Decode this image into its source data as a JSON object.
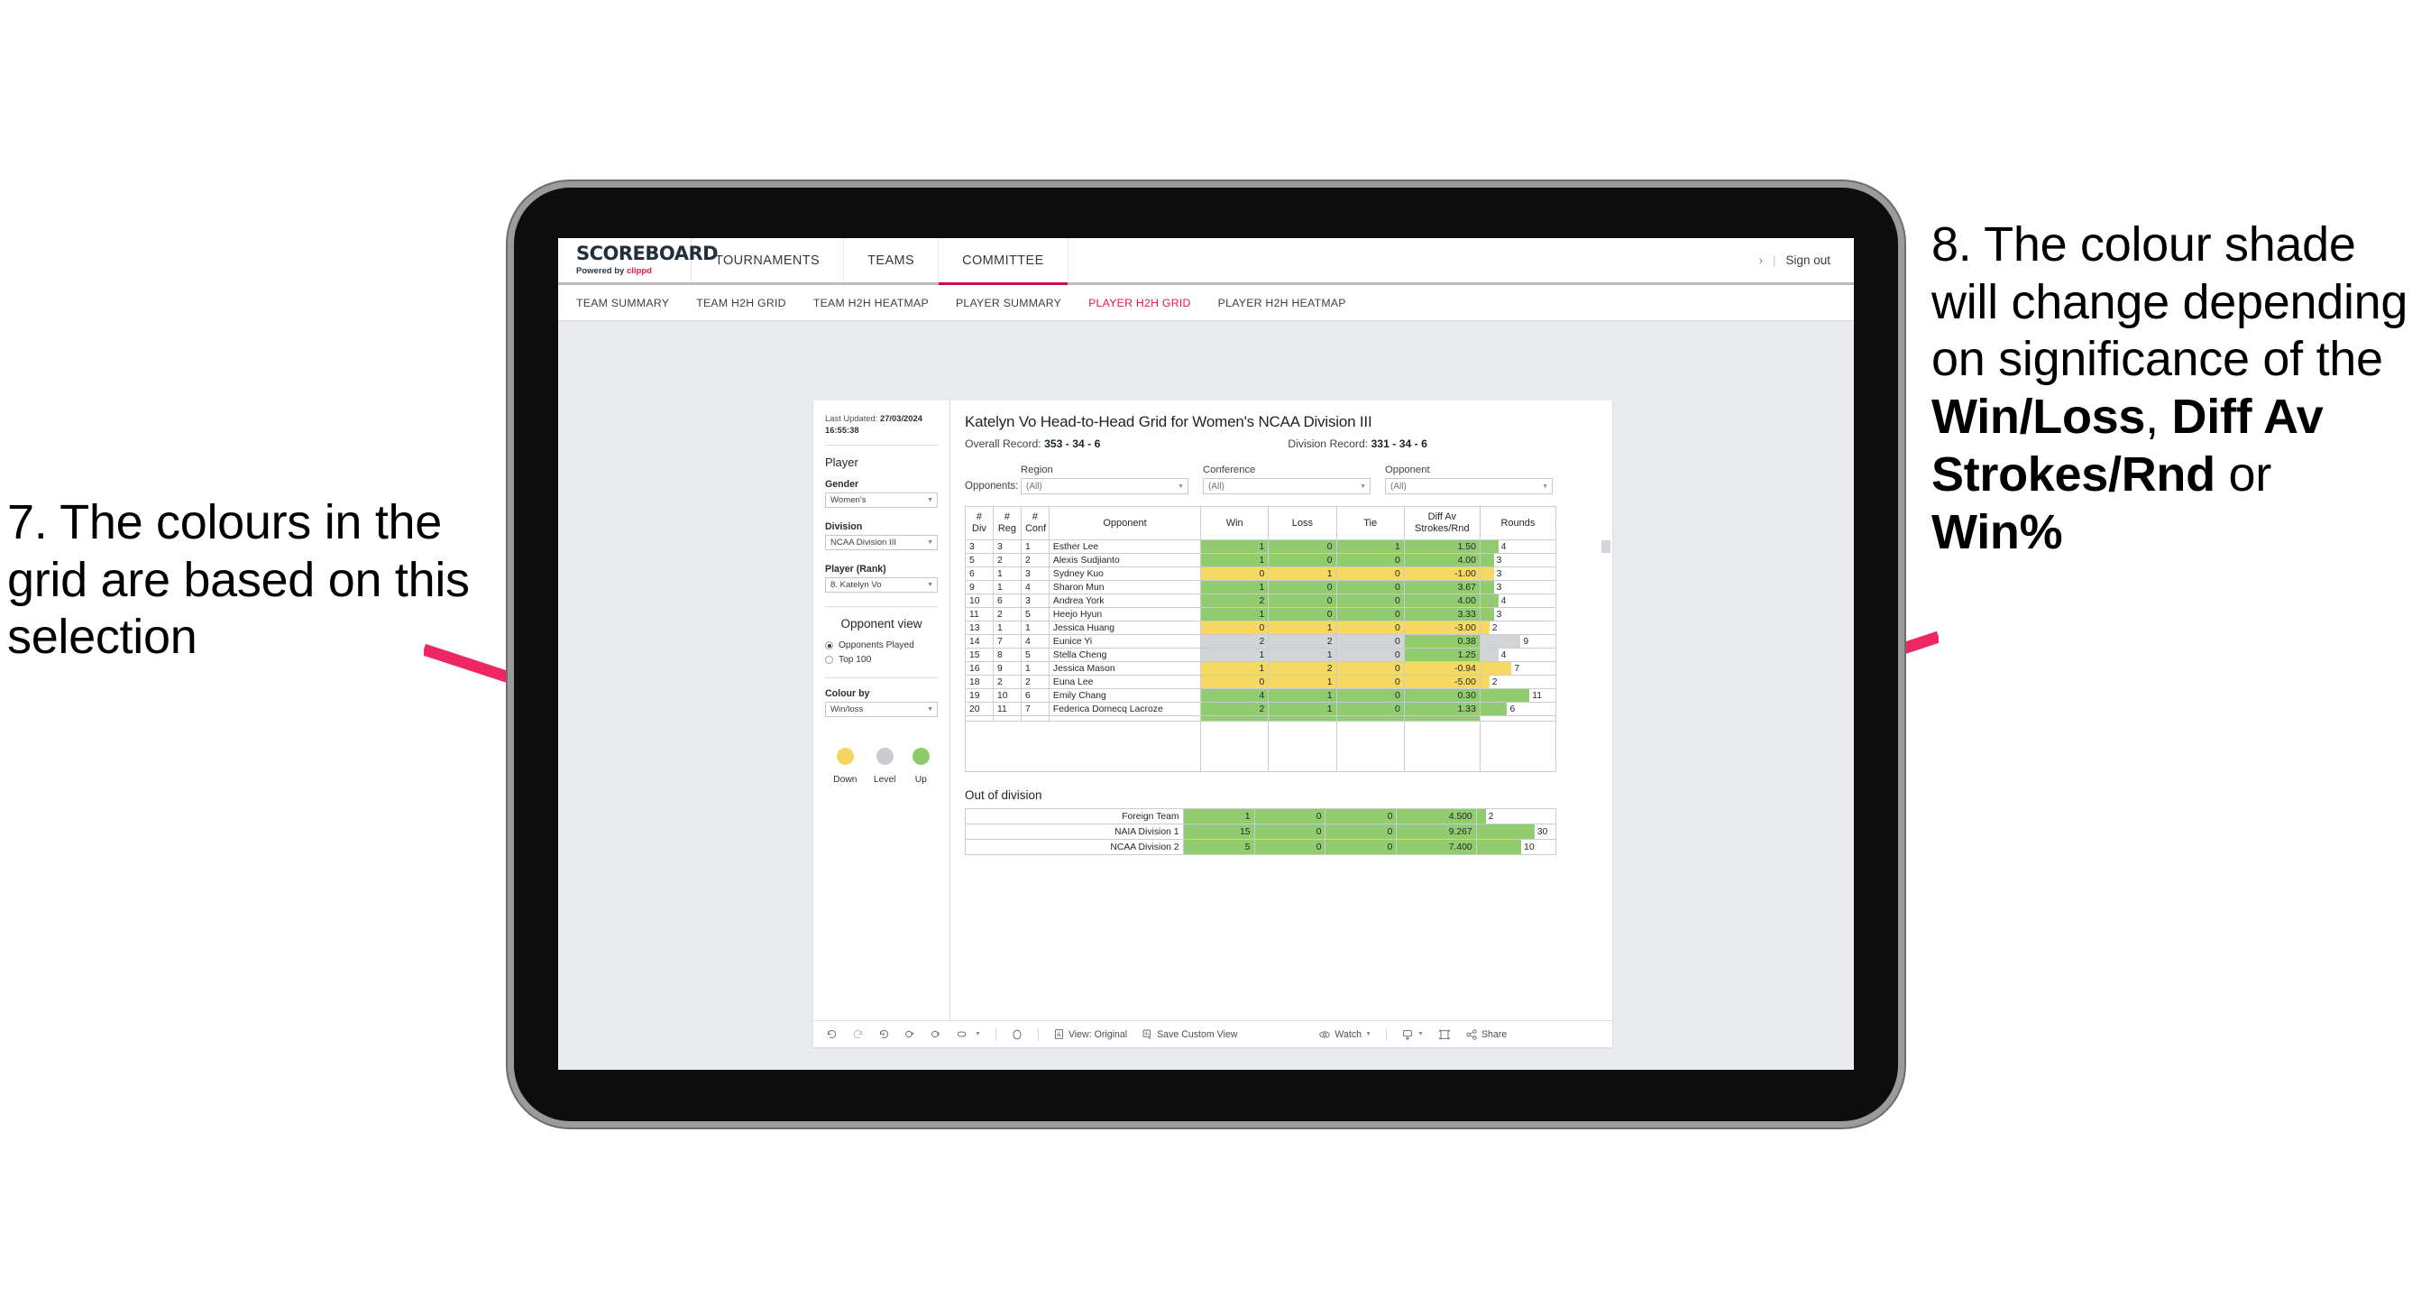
{
  "annotations": {
    "left": "7. The colours in the grid are based on this selection",
    "right_prefix": "8. The colour shade will change depending on significance of the ",
    "right_b1": "Win/Loss",
    "right_mid1": ", ",
    "right_b2": "Diff Av Strokes/Rnd",
    "right_mid2": " or ",
    "right_b3": "Win%"
  },
  "app": {
    "logo_main": "SCOREBOARD",
    "logo_sub_prefix": "Powered by ",
    "logo_sub_brand": "clippd",
    "top_nav": [
      {
        "label": "TOURNAMENTS",
        "active": false
      },
      {
        "label": "TEAMS",
        "active": false
      },
      {
        "label": "COMMITTEE",
        "active": true
      }
    ],
    "signout": {
      "chevron": "›",
      "divider": "|",
      "label": "Sign out"
    },
    "sub_nav": [
      {
        "label": "TEAM SUMMARY",
        "active": false
      },
      {
        "label": "TEAM H2H GRID",
        "active": false
      },
      {
        "label": "TEAM H2H HEATMAP",
        "active": false
      },
      {
        "label": "PLAYER SUMMARY",
        "active": false
      },
      {
        "label": "PLAYER H2H GRID",
        "active": true
      },
      {
        "label": "PLAYER H2H HEATMAP",
        "active": false
      }
    ],
    "accent_color": "#e8174c"
  },
  "sidebar": {
    "last_updated_label": "Last Updated:",
    "last_updated_value": "27/03/2024 16:55:38",
    "player_heading": "Player",
    "gender_label": "Gender",
    "gender_value": "Women's",
    "division_label": "Division",
    "division_value": "NCAA Division III",
    "player_rank_label": "Player (Rank)",
    "player_rank_value": "8. Katelyn Vo",
    "opponent_view_heading": "Opponent view",
    "opponent_view_options": [
      {
        "label": "Opponents Played",
        "selected": true
      },
      {
        "label": "Top 100",
        "selected": false
      }
    ],
    "colour_by_label": "Colour by",
    "colour_by_value": "Win/loss",
    "legend": [
      {
        "caption": "Down",
        "color": "#f5d45f"
      },
      {
        "caption": "Level",
        "color": "#c9cbce"
      },
      {
        "caption": "Up",
        "color": "#8ccb68"
      }
    ]
  },
  "main": {
    "title": "Katelyn Vo Head-to-Head Grid for Women's NCAA Division III",
    "overall_record_label": "Overall Record:",
    "overall_record_value": "353 - 34 - 6",
    "division_record_label": "Division Record:",
    "division_record_value": "331 - 34 - 6",
    "opponents_label": "Opponents:",
    "filters": [
      {
        "label": "Region",
        "value": "(All)"
      },
      {
        "label": "Conference",
        "value": "(All)"
      },
      {
        "label": "Opponent",
        "value": "(All)"
      }
    ],
    "out_of_division_title": "Out of division"
  },
  "chart_data": {
    "type": "table",
    "title": "Katelyn Vo Head-to-Head Grid for Women's NCAA Division III",
    "columns": [
      "# Div",
      "# Reg",
      "# Conf",
      "Opponent",
      "Win",
      "Loss",
      "Tie",
      "Diff Av Strokes/Rnd",
      "Rounds"
    ],
    "column_header_lines": [
      [
        "#",
        "Div"
      ],
      [
        "#",
        "Reg"
      ],
      [
        "#",
        "Conf"
      ],
      [
        "Opponent"
      ],
      [
        "Win"
      ],
      [
        "Loss"
      ],
      [
        "Tie"
      ],
      [
        "Diff Av",
        "Strokes/Rnd"
      ],
      [
        "Rounds"
      ]
    ],
    "rounds_max": 30,
    "rows": [
      {
        "div": "3",
        "reg": "3",
        "conf": "1",
        "opponent": "Esther Lee",
        "win": "1",
        "loss": "0",
        "tie": "1",
        "diff": "1.50",
        "rounds": "4",
        "state": "up"
      },
      {
        "div": "5",
        "reg": "2",
        "conf": "2",
        "opponent": "Alexis Sudjianto",
        "win": "1",
        "loss": "0",
        "tie": "0",
        "diff": "4.00",
        "rounds": "3",
        "state": "up"
      },
      {
        "div": "6",
        "reg": "1",
        "conf": "3",
        "opponent": "Sydney Kuo",
        "win": "0",
        "loss": "1",
        "tie": "0",
        "diff": "-1.00",
        "rounds": "3",
        "state": "down"
      },
      {
        "div": "9",
        "reg": "1",
        "conf": "4",
        "opponent": "Sharon Mun",
        "win": "1",
        "loss": "0",
        "tie": "0",
        "diff": "3.67",
        "rounds": "3",
        "state": "up"
      },
      {
        "div": "10",
        "reg": "6",
        "conf": "3",
        "opponent": "Andrea York",
        "win": "2",
        "loss": "0",
        "tie": "0",
        "diff": "4.00",
        "rounds": "4",
        "state": "up"
      },
      {
        "div": "11",
        "reg": "2",
        "conf": "5",
        "opponent": "Heejo Hyun",
        "win": "1",
        "loss": "0",
        "tie": "0",
        "diff": "3.33",
        "rounds": "3",
        "state": "up"
      },
      {
        "div": "13",
        "reg": "1",
        "conf": "1",
        "opponent": "Jessica Huang",
        "win": "0",
        "loss": "1",
        "tie": "0",
        "diff": "-3.00",
        "rounds": "2",
        "state": "down"
      },
      {
        "div": "14",
        "reg": "7",
        "conf": "4",
        "opponent": "Eunice Yi",
        "win": "2",
        "loss": "2",
        "tie": "0",
        "diff": "0.38",
        "rounds": "9",
        "state": "level",
        "diff_state": "up"
      },
      {
        "div": "15",
        "reg": "8",
        "conf": "5",
        "opponent": "Stella Cheng",
        "win": "1",
        "loss": "1",
        "tie": "0",
        "diff": "1.25",
        "rounds": "4",
        "state": "level",
        "diff_state": "up"
      },
      {
        "div": "16",
        "reg": "9",
        "conf": "1",
        "opponent": "Jessica Mason",
        "win": "1",
        "loss": "2",
        "tie": "0",
        "diff": "-0.94",
        "rounds": "7",
        "state": "down"
      },
      {
        "div": "18",
        "reg": "2",
        "conf": "2",
        "opponent": "Euna Lee",
        "win": "0",
        "loss": "1",
        "tie": "0",
        "diff": "-5.00",
        "rounds": "2",
        "state": "down"
      },
      {
        "div": "19",
        "reg": "10",
        "conf": "6",
        "opponent": "Emily Chang",
        "win": "4",
        "loss": "1",
        "tie": "0",
        "diff": "0.30",
        "rounds": "11",
        "state": "up"
      },
      {
        "div": "20",
        "reg": "11",
        "conf": "7",
        "opponent": "Federica Domecq Lacroze",
        "win": "2",
        "loss": "1",
        "tie": "0",
        "diff": "1.33",
        "rounds": "6",
        "state": "up"
      }
    ],
    "out_of_division_rows": [
      {
        "name": "Foreign Team",
        "win": "1",
        "loss": "0",
        "tie": "0",
        "diff": "4.500",
        "rounds": "2",
        "state": "up"
      },
      {
        "name": "NAIA Division 1",
        "win": "15",
        "loss": "0",
        "tie": "0",
        "diff": "9.267",
        "rounds": "30",
        "state": "up"
      },
      {
        "name": "NCAA Division 2",
        "win": "5",
        "loss": "0",
        "tie": "0",
        "diff": "7.400",
        "rounds": "10",
        "state": "up"
      }
    ]
  },
  "toolbar": {
    "view_label": "View: Original",
    "save_label": "Save Custom View",
    "watch_label": "Watch",
    "share_label": "Share"
  }
}
